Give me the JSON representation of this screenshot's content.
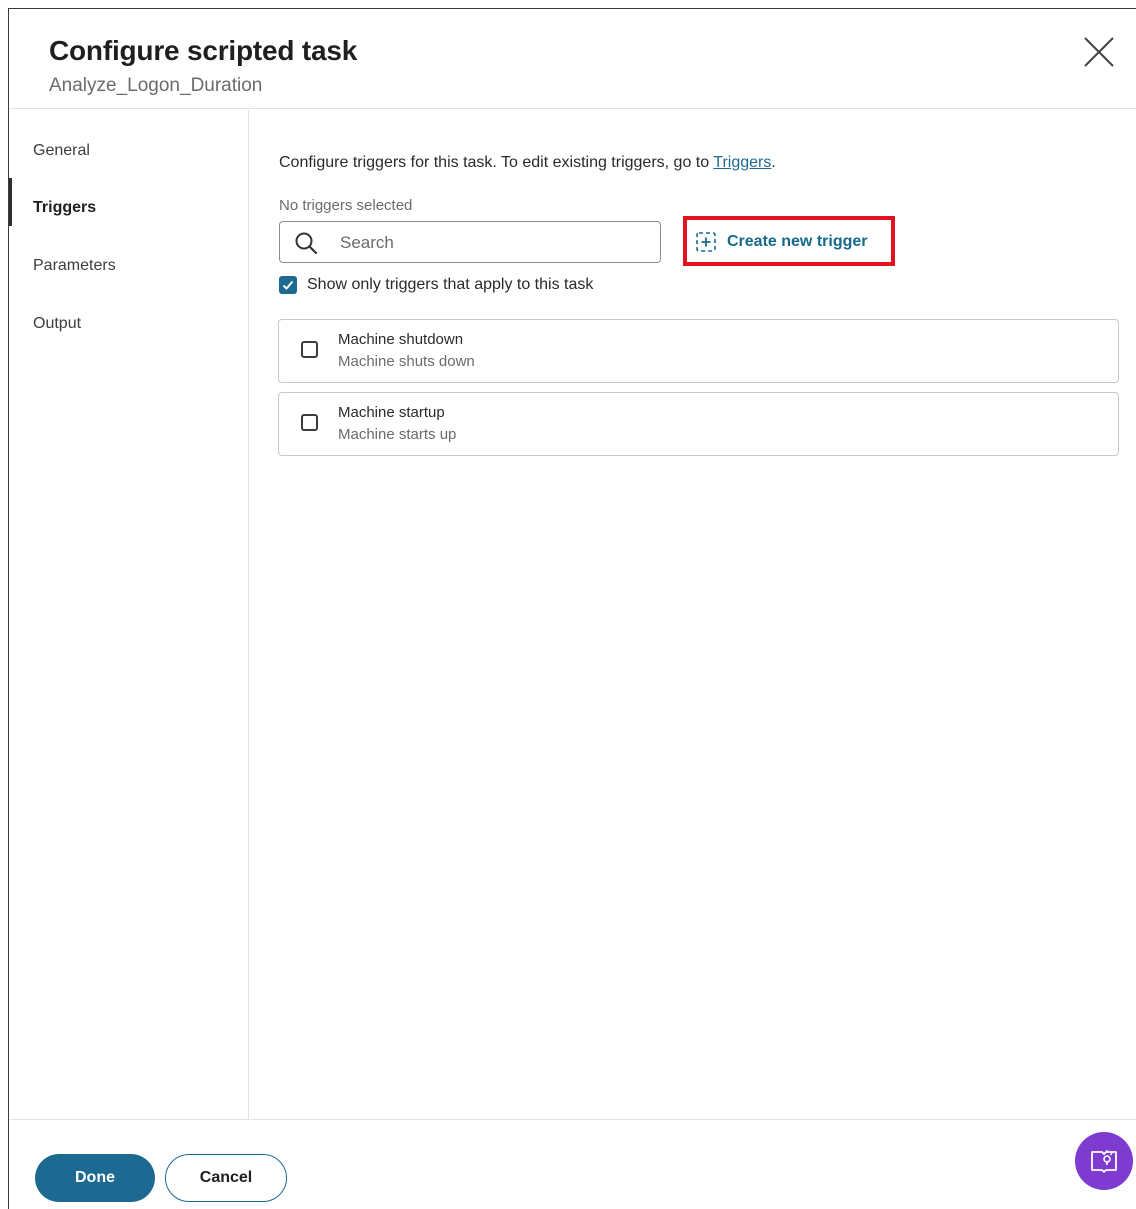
{
  "dialog": {
    "title": "Configure scripted task",
    "subtitle": "Analyze_Logon_Duration",
    "close_icon": "close-icon"
  },
  "sidebar": {
    "items": [
      {
        "label": "General",
        "active": false
      },
      {
        "label": "Triggers",
        "active": true
      },
      {
        "label": "Parameters",
        "active": false
      },
      {
        "label": "Output",
        "active": false
      }
    ]
  },
  "main": {
    "intro_text": "Configure triggers for this task. To edit existing triggers, go to ",
    "intro_link": "Triggers",
    "intro_suffix": ".",
    "selected_note": "No triggers selected",
    "search": {
      "placeholder": "Search",
      "value": "",
      "icon": "search-icon"
    },
    "create_button": {
      "label": "Create new trigger",
      "icon": "add-box-icon"
    },
    "filter": {
      "label": "Show only triggers that apply to this task",
      "checked": true
    },
    "triggers": [
      {
        "name": "Machine shutdown",
        "description": "Machine shuts down",
        "checked": false
      },
      {
        "name": "Machine startup",
        "description": "Machine starts up",
        "checked": false
      }
    ]
  },
  "footer": {
    "done_label": "Done",
    "cancel_label": "Cancel",
    "help_icon": "help-book-icon"
  },
  "colors": {
    "accent": "#1c6a92",
    "link": "#176a8c",
    "highlight_border": "#e0131e",
    "help_fab": "#7d3ccf"
  }
}
